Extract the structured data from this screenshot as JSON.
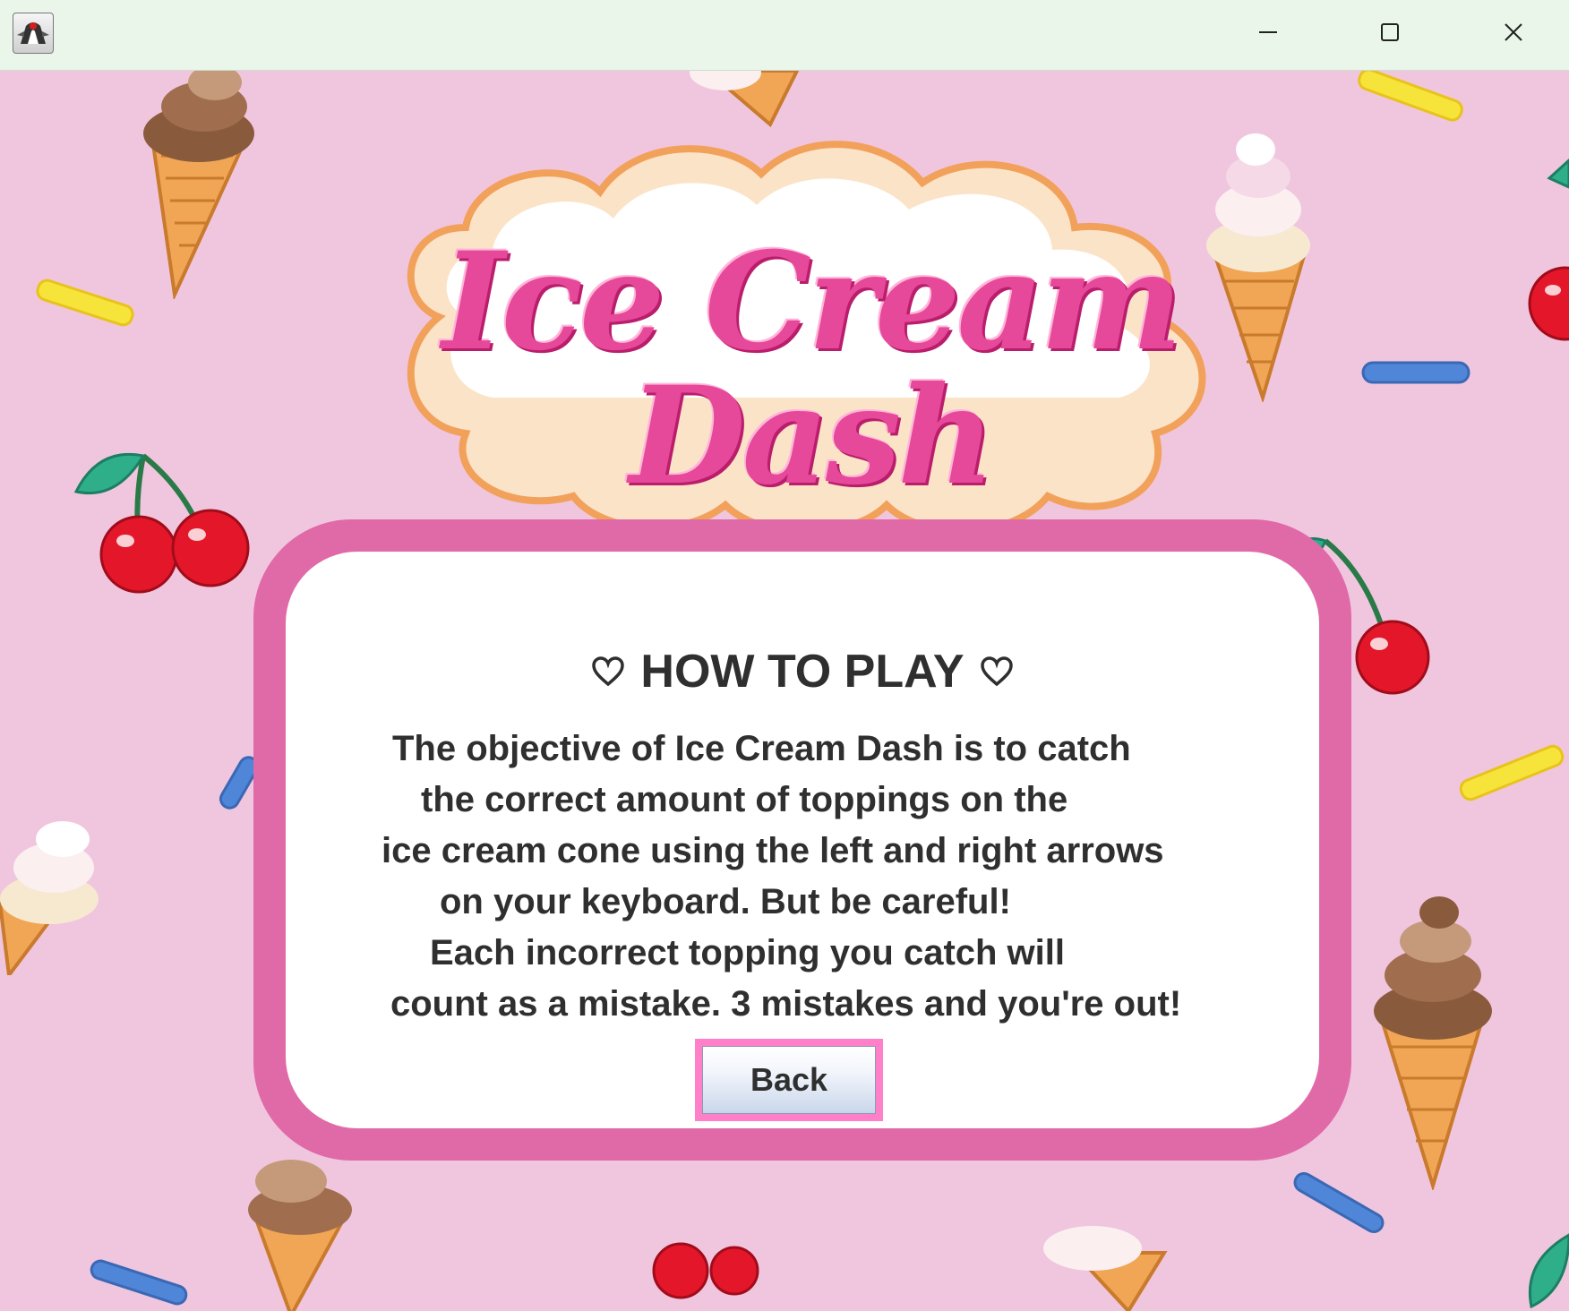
{
  "window": {
    "icon": "java-duke-icon",
    "controls": [
      "minimize-icon",
      "maximize-icon",
      "close-icon"
    ]
  },
  "logo": {
    "line1": "Ice Cream",
    "line2": "Dash"
  },
  "panel": {
    "title": "HOW TO PLAY",
    "heart_icon": "heart-outline-icon",
    "lines": [
      "The objective of Ice Cream Dash is to catch",
      "the correct amount of toppings on the",
      "ice cream cone using the left and right arrows",
      "on your keyboard. But be careful!",
      "Each incorrect topping you catch will",
      "count as a mistake. 3 mistakes and you're out!"
    ],
    "back_label": "Back"
  },
  "colors": {
    "background": "#f0c6df",
    "panel_border": "#e06aa8",
    "panel_fill": "#ffffff",
    "logo_pink": "#e6489a",
    "button_highlight": "#ff80c8",
    "text": "#2f2f2f"
  }
}
